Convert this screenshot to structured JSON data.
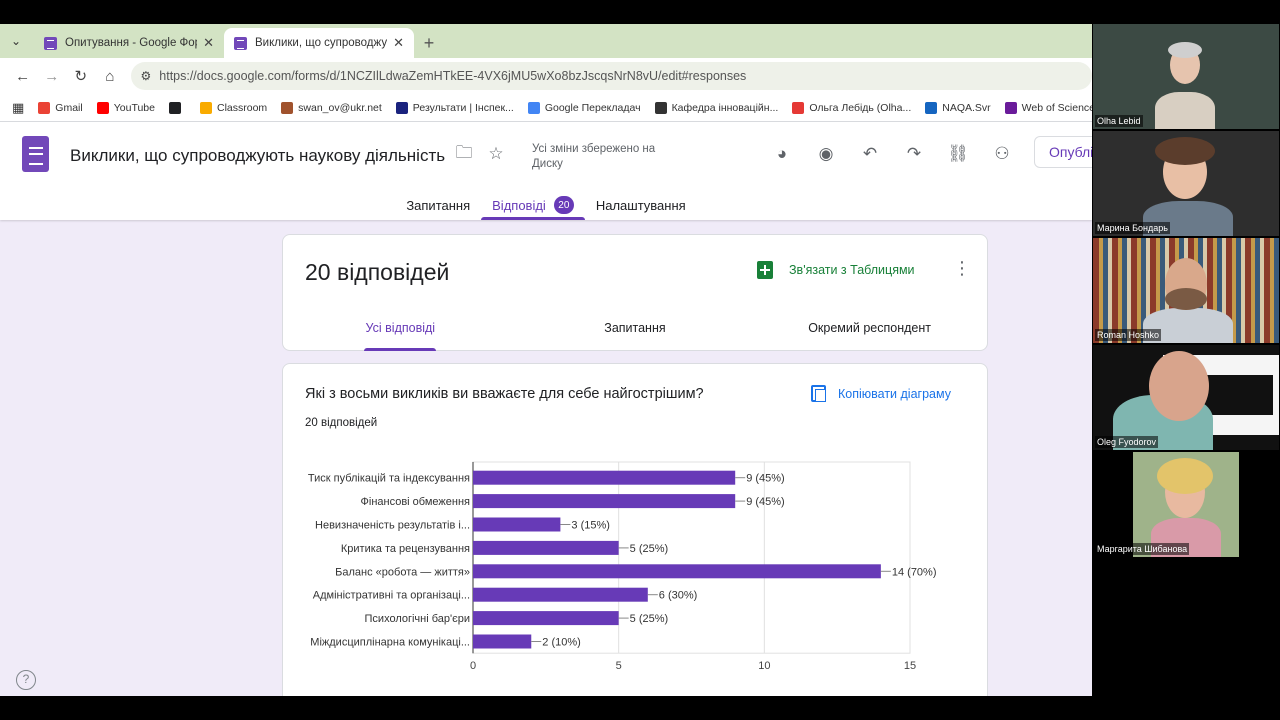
{
  "browser": {
    "tabs": [
      {
        "title": "Опитування - Google Форми",
        "active": false
      },
      {
        "title": "Виклики, що супроводжують н",
        "active": true
      }
    ],
    "url": "https://docs.google.com/forms/d/1NCZIlLdwaZemHTkEE-4VX6jMU5wXo8bzJscqsNrN8vU/edit#responses",
    "bookmarks": [
      {
        "label": "Gmail",
        "color": "#ea4335"
      },
      {
        "label": "YouTube",
        "color": "#ff0000"
      },
      {
        "label": "",
        "color": "#202124"
      },
      {
        "label": "Classroom",
        "color": "#f9ab00"
      },
      {
        "label": "swan_ov@ukr.net",
        "color": "#a0522d"
      },
      {
        "label": "Результати | Інспек...",
        "color": "#1a237e"
      },
      {
        "label": "Google Перекладач",
        "color": "#4285f4"
      },
      {
        "label": "Кафедра інноваційн...",
        "color": "#333333"
      },
      {
        "label": "Ольга Лебідь (Olha...",
        "color": "#e53935"
      },
      {
        "label": "NAQA.Svr",
        "color": "#1565c0"
      },
      {
        "label": "Web of Science Cor...",
        "color": "#6a1b9a"
      }
    ]
  },
  "form": {
    "title": "Виклики, що супроводжують наукову діяльність",
    "saved_note": "Усі зміни збережено на Диску",
    "publish_label": "Опублі",
    "nav": {
      "questions": "Запитання",
      "responses": "Відповіді",
      "responses_count": "20",
      "settings": "Налаштування"
    }
  },
  "summary": {
    "count_label": "20 відповідей",
    "sheets_link": "Зв'язати з Таблицями",
    "tabs": [
      "Усі відповіді",
      "Запитання",
      "Окремий респондент"
    ]
  },
  "question": {
    "title": "Які з восьми викликів ви вважаєте для себе найгострішим?",
    "responses": "20 відповідей",
    "copy_chart": "Копіювати діаграму"
  },
  "chart_data": {
    "type": "bar",
    "orientation": "horizontal",
    "categories": [
      "Тиск публікацій та індексування",
      "Фінансові обмеження",
      "Невизначеність результатів і...",
      "Критика та рецензування",
      "Баланс «робота — життя»",
      "Адміністративні та організаці...",
      "Психологічні бар'єри",
      "Міждисциплінарна комунікаці..."
    ],
    "values": [
      9,
      9,
      3,
      5,
      14,
      6,
      5,
      2
    ],
    "data_labels": [
      "9 (45%)",
      "9 (45%)",
      "3 (15%)",
      "5 (25%)",
      "14 (70%)",
      "6 (30%)",
      "5 (25%)",
      "2 (10%)"
    ],
    "xlim": [
      0,
      15
    ],
    "xticks": [
      0,
      5,
      10,
      15
    ],
    "bar_color": "#673ab7",
    "grid": true
  },
  "participants": [
    {
      "name": "Olha Lebid"
    },
    {
      "name": "Марина Бондарь"
    },
    {
      "name": "Roman Hoshko"
    },
    {
      "name": "Oleg Fyodorov"
    },
    {
      "name": "Маргарита Шибанова"
    }
  ],
  "colors": {
    "accent": "#673ab7",
    "background": "#f0ebf8"
  }
}
